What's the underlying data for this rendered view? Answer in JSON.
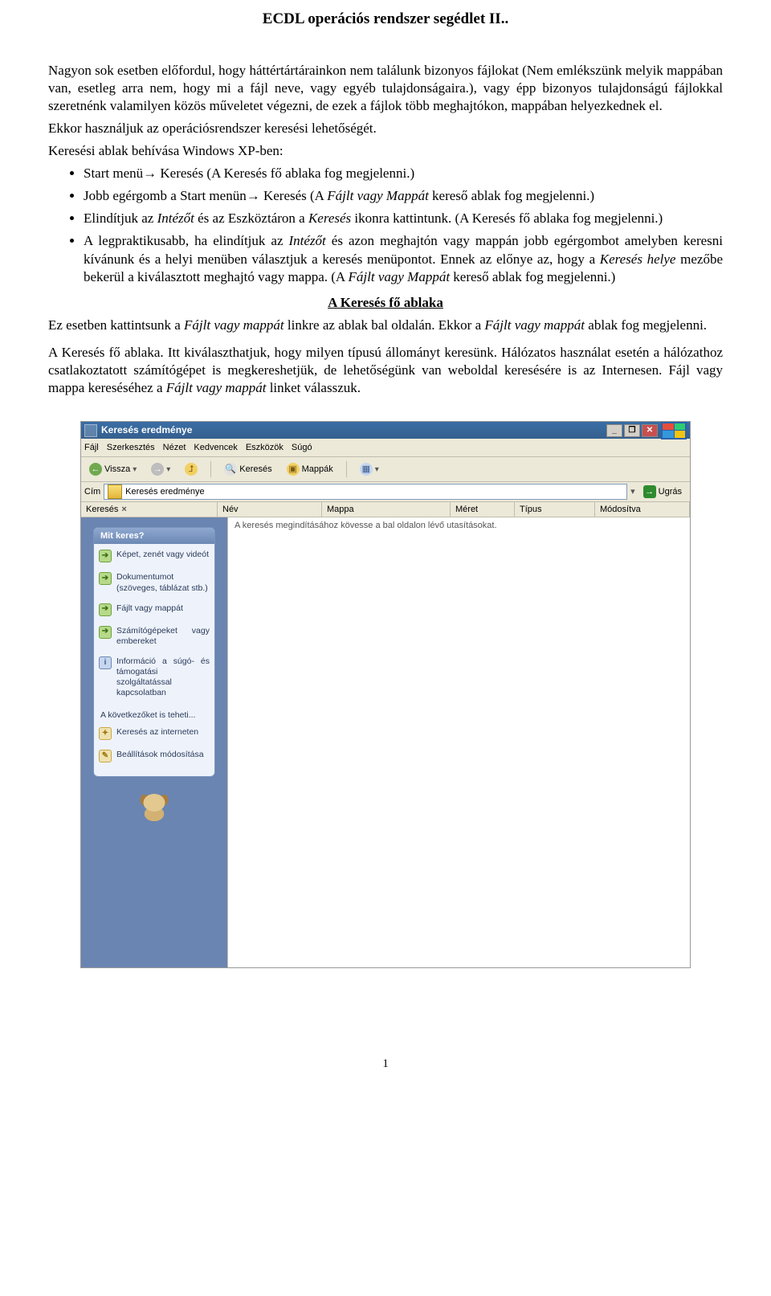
{
  "doc_title": "ECDL operációs rendszer segédlet II..",
  "para1": "Nagyon sok esetben előfordul, hogy háttértártárainkоn nem találunk bizonyos fájlokat (Nem emlékszünk melyik mappában van, esetleg arra nem, hogy mi a fájl neve, vagy egyéb tulajdonságaira.), vagy épp bizonyos tulajdonságú fájlokkal szeretnénk valamilyen közös műveletet végezni, de ezek a fájlok több meghajtókon, mappában helyezkednek el.",
  "para2": "Ekkor használjuk az operációsrendszer keresési lehetőségét.",
  "para3": "Keresési ablak behívása Windows XP-ben:",
  "bullets": [
    "Start menü→ Keresés (A Keresés fő ablaka fog megjelenni.)",
    "Jobb egérgomb a Start menün→ Keresés (A <em>Fájlt vagy Mappát</em> kereső ablak fog megjelenni.)",
    "Elindítjuk az <em>Intézőt</em> és az Eszköztáron a <em>Keresés</em> ikonra kattintunk. (A Keresés fő ablaka fog megjelenni.)",
    "A legpraktikusabb, ha elindítjuk az <em>Intézőt</em> és azon meghajtón vagy mappán jobb egérgombot amelyben keresni kívánunk és a helyi menüben választjuk a keresés menüpontot. Ennek az előnye az, hogy a <em>Keresés helye</em> mezőbe bekerül a kiválasztott meghajtó vagy mappa. (A <em>Fájlt vagy Mappát</em> kereső ablak fog megjelenni.)"
  ],
  "section_heading": "A Keresés fő ablaka",
  "para4": "Ez esetben kattintsunk a <em>Fájlt vagy mappát</em> linkre az ablak bal oldalán. Ekkor a <em>Fájlt vagy mappát</em> ablak fog megjelenni.",
  "para5": "A Keresés fő ablaka. Itt kiválaszthatjuk, hogy milyen típusú állományt keresünk. Hálózatos használat esetén a hálózathoz csatlakoztatott számítógépet is megkereshetjük, de lehetőségünk van weboldal keresésére is az Internesen. Fájl vagy mappa kereséséhez a <em>Fájlt vagy mappát</em> linket válasszuk.",
  "page_number": "1",
  "win": {
    "title": "Keresés eredménye",
    "menu": [
      "Fájl",
      "Szerkesztés",
      "Nézet",
      "Kedvencek",
      "Eszközök",
      "Súgó"
    ],
    "toolbar": {
      "back": "Vissza",
      "search": "Keresés",
      "folders": "Mappák"
    },
    "addressbar": {
      "label": "Cím",
      "value": "Keresés eredménye",
      "go": "Ugrás"
    },
    "columns": {
      "search_panel": "Keresés",
      "name": "Név",
      "folder": "Mappa",
      "size": "Méret",
      "type": "Típus",
      "modified": "Módosítva"
    },
    "content_hint": "A keresés megindításához kövesse a bal oldalon lévő utasításokat.",
    "box1": {
      "title": "Mit keres?",
      "items": [
        "Képet, zenét vagy videót",
        "Dokumentumot (szöveges, táblázat stb.)",
        "Fájlt vagy mappát",
        "Számítógépeket vagy embereket",
        "Információ a súgó- és támogatási szolgáltatással kapcsolatban"
      ]
    },
    "box2": {
      "title": "A következőket is teheti...",
      "items": [
        "Keresés az interneten",
        "Beállítások módosítása"
      ]
    }
  }
}
